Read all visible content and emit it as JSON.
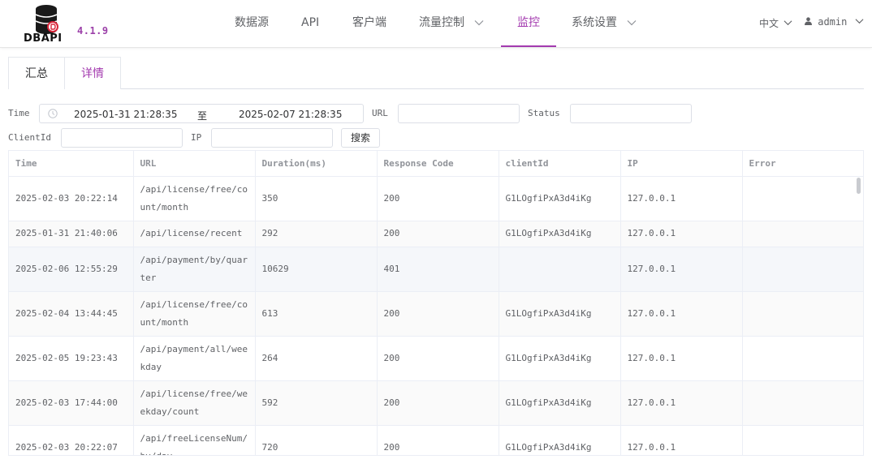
{
  "app": {
    "logo_text": "DBAPI",
    "version": "4.1.9"
  },
  "nav": {
    "items": [
      {
        "label": "数据源"
      },
      {
        "label": "API"
      },
      {
        "label": "客户端"
      },
      {
        "label": "流量控制"
      },
      {
        "label": "监控"
      },
      {
        "label": "系统设置"
      }
    ],
    "active": "监控",
    "language": "中文",
    "user": "admin"
  },
  "tabs": [
    "汇总",
    "详情"
  ],
  "active_tab": "详情",
  "filters": {
    "time_label": "Time",
    "time_start": "2025-01-31 21:28:35",
    "time_separator": "至",
    "time_end": "2025-02-07 21:28:35",
    "url_label": "URL",
    "url_value": "",
    "status_label": "Status",
    "status_value": "",
    "clientid_label": "ClientId",
    "clientid_value": "",
    "ip_label": "IP",
    "ip_value": "",
    "search_button": "搜索"
  },
  "table": {
    "columns": [
      "Time",
      "URL",
      "Duration(ms)",
      "Response Code",
      "clientId",
      "IP",
      "Error"
    ],
    "rows": [
      {
        "time": "2025-02-03 20:22:14",
        "url": "/api/license/free/count/month",
        "duration": "350",
        "code": "200",
        "client": "G1LOgfiPxA3d4iKg",
        "ip": "127.0.0.1",
        "error": ""
      },
      {
        "time": "2025-01-31 21:40:06",
        "url": "/api/license/recent",
        "duration": "292",
        "code": "200",
        "client": "G1LOgfiPxA3d4iKg",
        "ip": "127.0.0.1",
        "error": ""
      },
      {
        "time": "2025-02-06 12:55:29",
        "url": "/api/payment/by/quarter",
        "duration": "10629",
        "code": "401",
        "client": "",
        "ip": "127.0.0.1",
        "error": ""
      },
      {
        "time": "2025-02-04 13:44:45",
        "url": "/api/license/free/count/month",
        "duration": "613",
        "code": "200",
        "client": "G1LOgfiPxA3d4iKg",
        "ip": "127.0.0.1",
        "error": ""
      },
      {
        "time": "2025-02-05 19:23:43",
        "url": "/api/payment/all/weekday",
        "duration": "264",
        "code": "200",
        "client": "G1LOgfiPxA3d4iKg",
        "ip": "127.0.0.1",
        "error": ""
      },
      {
        "time": "2025-02-03 17:44:00",
        "url": "/api/license/free/weekday/count",
        "duration": "592",
        "code": "200",
        "client": "G1LOgfiPxA3d4iKg",
        "ip": "127.0.0.1",
        "error": ""
      },
      {
        "time": "2025-02-03 20:22:07",
        "url": "/api/freeLicenseNum/by/day",
        "duration": "720",
        "code": "200",
        "client": "G1LOgfiPxA3d4iKg",
        "ip": "127.0.0.1",
        "error": ""
      }
    ]
  },
  "colors": {
    "accent": "#a33aaf",
    "version": "#9b3fa8"
  }
}
